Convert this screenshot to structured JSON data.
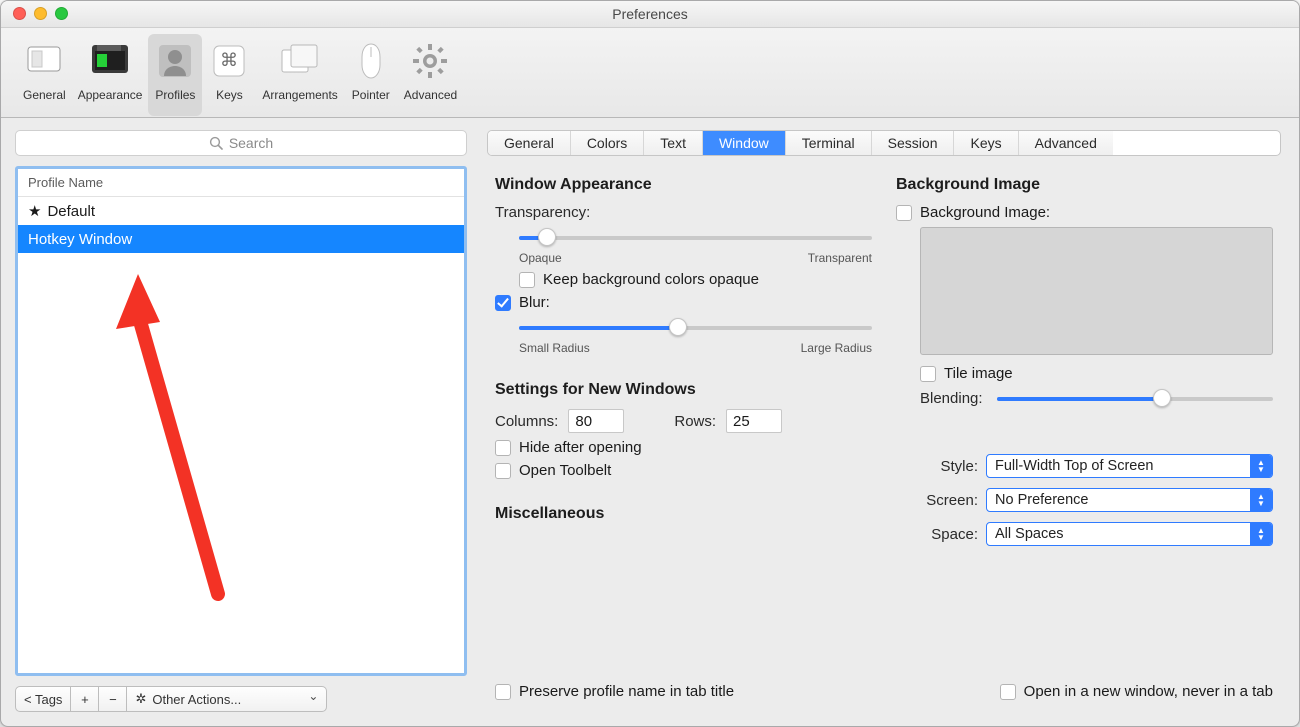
{
  "window": {
    "title": "Preferences"
  },
  "toolbar": {
    "items": [
      {
        "label": "General"
      },
      {
        "label": "Appearance"
      },
      {
        "label": "Profiles"
      },
      {
        "label": "Keys"
      },
      {
        "label": "Arrangements"
      },
      {
        "label": "Pointer"
      },
      {
        "label": "Advanced"
      }
    ],
    "selected_index": 2
  },
  "sidebar": {
    "search_placeholder": "Search",
    "header": "Profile Name",
    "profiles": [
      {
        "name": "Default",
        "is_default": true
      },
      {
        "name": "Hotkey Window",
        "is_default": false
      }
    ],
    "selected_index": 1,
    "tags_label": "< Tags",
    "add_label": "+",
    "remove_label": "−",
    "other_actions_label": "Other Actions..."
  },
  "tabs": {
    "items": [
      "General",
      "Colors",
      "Text",
      "Window",
      "Terminal",
      "Session",
      "Keys",
      "Advanced"
    ],
    "active_index": 3
  },
  "sections": {
    "window_appearance": {
      "title": "Window Appearance",
      "transparency_label": "Transparency:",
      "transparency_value_pct": 8,
      "transparency_min_label": "Opaque",
      "transparency_max_label": "Transparent",
      "keep_bg_opaque": {
        "label": "Keep background colors opaque",
        "checked": false
      },
      "blur": {
        "label": "Blur:",
        "checked": true,
        "value_pct": 45,
        "min_label": "Small Radius",
        "max_label": "Large Radius"
      }
    },
    "new_windows": {
      "title": "Settings for New Windows",
      "columns_label": "Columns:",
      "columns_value": "80",
      "rows_label": "Rows:",
      "rows_value": "25",
      "hide_after_opening": {
        "label": "Hide after opening",
        "checked": false
      },
      "open_toolbelt": {
        "label": "Open Toolbelt",
        "checked": false
      }
    },
    "background_image": {
      "title": "Background Image",
      "enable": {
        "label": "Background Image:",
        "checked": false
      },
      "tile": {
        "label": "Tile image",
        "checked": false
      },
      "blending_label": "Blending:",
      "blending_value_pct": 60
    },
    "placement": {
      "style_label": "Style:",
      "style_value": "Full-Width Top of Screen",
      "screen_label": "Screen:",
      "screen_value": "No Preference",
      "space_label": "Space:",
      "space_value": "All Spaces"
    },
    "misc": {
      "title": "Miscellaneous",
      "preserve_name": {
        "label": "Preserve profile name in tab title",
        "checked": false
      },
      "open_new_window": {
        "label": "Open in a new window, never in a tab",
        "checked": false
      }
    }
  },
  "colors": {
    "accent": "#2f7bff",
    "selection": "#1586ff"
  }
}
